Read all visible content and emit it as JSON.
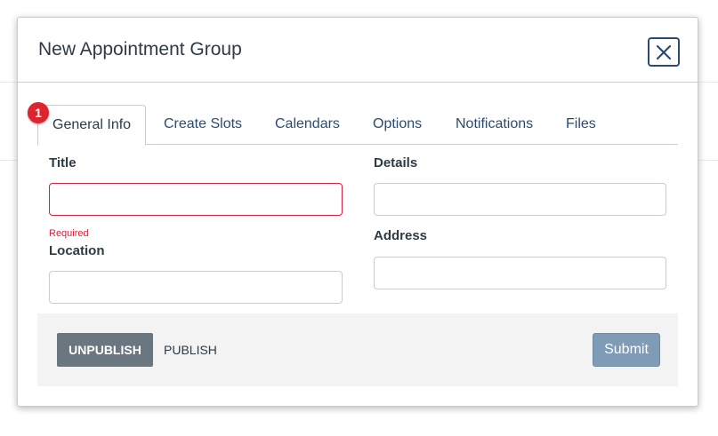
{
  "modal": {
    "title": "New Appointment Group",
    "close_icon": "close-icon"
  },
  "badge": {
    "number": "1"
  },
  "tabs": [
    {
      "label": "General Info",
      "active": true
    },
    {
      "label": "Create Slots",
      "active": false
    },
    {
      "label": "Calendars",
      "active": false
    },
    {
      "label": "Options",
      "active": false
    },
    {
      "label": "Notifications",
      "active": false
    },
    {
      "label": "Files",
      "active": false
    }
  ],
  "form": {
    "title_label": "Title",
    "title_value": "",
    "title_error": "Required",
    "location_label": "Location",
    "location_value": "",
    "details_label": "Details",
    "details_value": "",
    "address_label": "Address",
    "address_value": ""
  },
  "footer": {
    "unpublish_label": "UNPUBLISH",
    "publish_label": "PUBLISH",
    "submit_label": "Submit"
  },
  "colors": {
    "link": "#2b4a72",
    "error": "#d4233a",
    "badge": "#e0242e",
    "unpublish_bg": "#6b7780",
    "submit_bg": "#7f9bb6"
  }
}
